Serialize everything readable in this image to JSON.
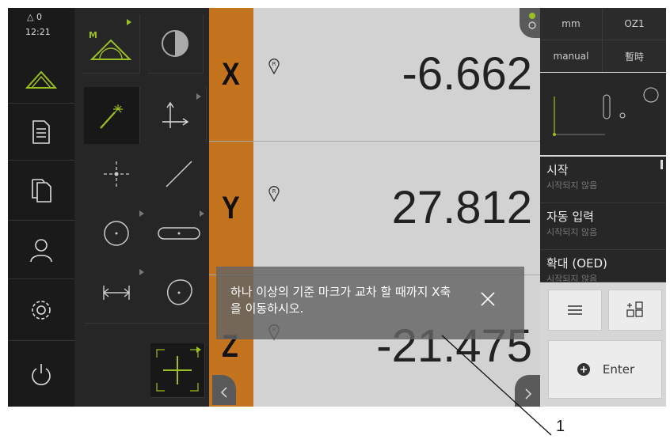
{
  "status": {
    "delta_label": "△ 0",
    "time": "12:21"
  },
  "sidebar": {
    "items": [
      {
        "icon": "measure-triangle-icon"
      },
      {
        "icon": "document-icon"
      },
      {
        "icon": "copy-document-icon"
      },
      {
        "icon": "user-icon"
      },
      {
        "icon": "settings-icon"
      },
      {
        "icon": "power-icon"
      }
    ]
  },
  "tools": {
    "mode_badge": "M",
    "items": [
      "measure-manual-icon",
      "contrast-icon",
      "auto-measure-wand-icon",
      "coordinate-system-icon",
      "point-icon",
      "line-icon",
      "circle-icon",
      "slot-icon",
      "distance-icon",
      "blob-icon",
      "crosshair-icon"
    ]
  },
  "axes": [
    {
      "label": "X",
      "value": "-6.662"
    },
    {
      "label": "Y",
      "value": "27.812"
    },
    {
      "label": "Z",
      "value": "-21.475"
    }
  ],
  "reference_marker": "R",
  "settings": {
    "unit": "mm",
    "zone": "OZ1",
    "mode": "manual",
    "pause": "暫時"
  },
  "sequence": [
    {
      "title": "시작",
      "status": "시작되지 않음"
    },
    {
      "title": "자동 입력",
      "status": "시작되지 않음"
    },
    {
      "title": "확대 (OED)",
      "status": "시작되지 않음"
    }
  ],
  "actions": {
    "enter_label": "Enter"
  },
  "message": {
    "text": "하나 이상의 기준 마크가 교차 할 때까지 X축을 이동하시오."
  },
  "callout": {
    "label": "1"
  },
  "colors": {
    "axis_bar": "#c4741f",
    "accent": "#9cbf22"
  }
}
